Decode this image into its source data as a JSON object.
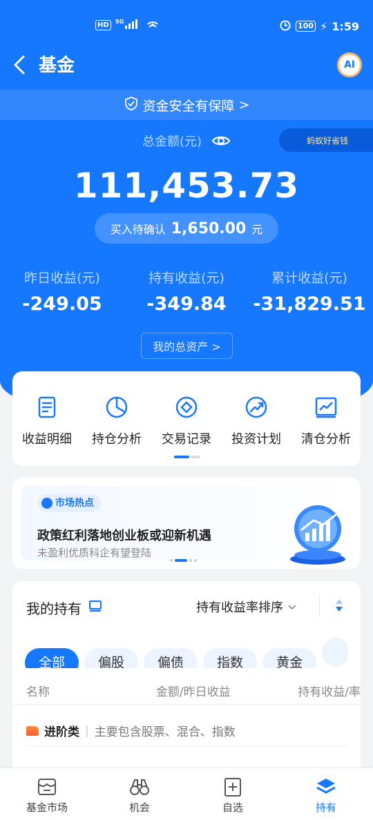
{
  "status_bar": {
    "hd": "HD",
    "signal": "5G",
    "battery": "100",
    "time": "1:59"
  },
  "header": {
    "title": "基金",
    "ai_label": "AI"
  },
  "safety_banner": {
    "text": "资金安全有保障",
    "chevron": ">"
  },
  "summary": {
    "total_label": "总金额(元)",
    "promo_label": "蚂蚁好省钱",
    "total_amount": "111,453.73",
    "pending_label": "买入待确认",
    "pending_amount": "1,650.00",
    "pending_unit": "元",
    "stats": [
      {
        "label": "昨日收益(元)",
        "value": "-249.05"
      },
      {
        "label": "持有收益(元)",
        "value": "-349.84"
      },
      {
        "label": "累计收益(元)",
        "value": "-31,829.51"
      }
    ],
    "assets_button": "我的总资产 >"
  },
  "actions": [
    {
      "label": "收益明细",
      "icon": "document-icon"
    },
    {
      "label": "持仓分析",
      "icon": "pie-chart-icon"
    },
    {
      "label": "交易记录",
      "icon": "exchange-icon"
    },
    {
      "label": "投资计划",
      "icon": "trend-icon"
    },
    {
      "label": "清仓分析",
      "icon": "line-chart-icon"
    }
  ],
  "hot": {
    "tag": "市场热点",
    "title": "政策红利落地创业板或迎新机遇",
    "subtitle": "未盈利优质科企有望登陆"
  },
  "holdings": {
    "title": "我的持有",
    "sort_label": "持有收益率排序",
    "chips": [
      "全部",
      "偏股",
      "偏债",
      "指数",
      "黄金"
    ],
    "columns": {
      "name": "名称",
      "amount": "金额/昨日收益",
      "rate": "持有收益/率"
    },
    "category": {
      "name": "进阶类",
      "separator": "|",
      "desc": "主要包含股票、混合、指数"
    }
  },
  "tabbar": [
    {
      "label": "基金市场",
      "icon": "market-icon"
    },
    {
      "label": "机会",
      "icon": "binoculars-icon"
    },
    {
      "label": "自选",
      "icon": "add-favorite-icon"
    },
    {
      "label": "持有",
      "icon": "layers-icon"
    }
  ],
  "colors": {
    "primary": "#1677ff",
    "background": "#f2f3f5"
  }
}
